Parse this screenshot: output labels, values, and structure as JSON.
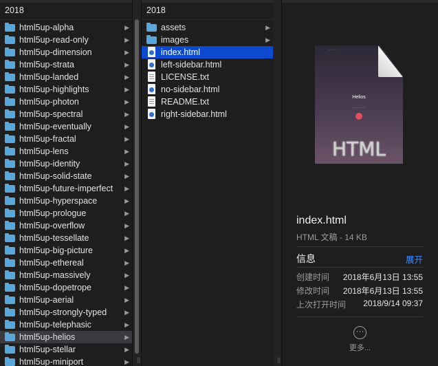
{
  "column1": {
    "header": "2018",
    "items": [
      "html5up-alpha",
      "html5up-read-only",
      "html5up-dimension",
      "html5up-strata",
      "html5up-landed",
      "html5up-highlights",
      "html5up-photon",
      "html5up-spectral",
      "html5up-eventually",
      "html5up-fractal",
      "html5up-lens",
      "html5up-identity",
      "html5up-solid-state",
      "html5up-future-imperfect",
      "html5up-hyperspace",
      "html5up-prologue",
      "html5up-overflow",
      "html5up-tessellate",
      "html5up-big-picture",
      "html5up-ethereal",
      "html5up-massively",
      "html5up-dopetrope",
      "html5up-aerial",
      "html5up-strongly-typed",
      "html5up-telephasic",
      "html5up-helios",
      "html5up-stellar",
      "html5up-miniport"
    ],
    "selected": "html5up-helios"
  },
  "column2": {
    "header": "2018",
    "items": [
      {
        "name": "assets",
        "type": "folder"
      },
      {
        "name": "images",
        "type": "folder"
      },
      {
        "name": "index.html",
        "type": "html"
      },
      {
        "name": "left-sidebar.html",
        "type": "html"
      },
      {
        "name": "LICENSE.txt",
        "type": "txt"
      },
      {
        "name": "no-sidebar.html",
        "type": "html"
      },
      {
        "name": "README.txt",
        "type": "txt"
      },
      {
        "name": "right-sidebar.html",
        "type": "html"
      }
    ],
    "selected": "index.html"
  },
  "preview": {
    "thumb_title": "Helios",
    "thumb_badge": "HTML",
    "file_name": "index.html",
    "file_kind": "HTML 文稿 - 14 KB",
    "info_heading": "信息",
    "expand_label": "展开",
    "rows": [
      {
        "label": "创建时间",
        "value": "2018年6月13日 13:55"
      },
      {
        "label": "修改时间",
        "value": "2018年6月13日 13:55"
      },
      {
        "label": "上次打开时间",
        "value": "2018/9/14 09:37"
      }
    ],
    "more_label": "更多..."
  },
  "colors": {
    "selection_blue": "#0e4ad0",
    "folder_blue": "#5aa7dc",
    "link_blue": "#3e8cf0"
  }
}
